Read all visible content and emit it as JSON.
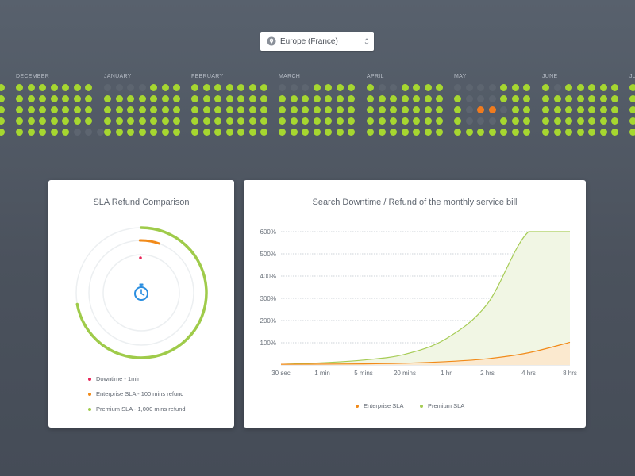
{
  "region": {
    "selected": "Europe (France)",
    "icon": "location-pin-icon"
  },
  "calendar": {
    "months": [
      {
        "label": "DECEMBER",
        "status": "GGGGGGG/GGGGGGG/GGGGGGG/GGGGGGG/GGGGGDDD"
      },
      {
        "label": "JANUARY",
        "status": "DDDDGGG/GGGGGGG/GGGGGGG/GGGGGGG/GGGGGGG"
      },
      {
        "label": "FEBRUARY",
        "status": "GGGGGGG/GGGGGGG/GGGGGGG/GGGGGGG/GGGGGGG"
      },
      {
        "label": "MARCH",
        "status": "DDDGGGG/GGGGGGG/GGGGGGG/GGGGGGG/GGGGGGG"
      },
      {
        "label": "APRIL",
        "status": "GDDGGGG/GGGGGGG/GGGGGGG/GGGGGGG/GGGGGGG"
      },
      {
        "label": "MAY",
        "status": "DDDDGGG/GDDDGGG/GDOODGG/GDDDGGG/GGGGGGG"
      },
      {
        "label": "JUNE",
        "status": "GDGGGGG/GGGGGGG/GGGGGGG/GGGGGGG/GGGGGGG"
      },
      {
        "label": "JU",
        "status": "G/G/G/G/G"
      }
    ],
    "colors": {
      "up": "#a6d730",
      "down": "#5d6570",
      "incident": "#f07b1e"
    }
  },
  "sla_card": {
    "title": "SLA Refund Comparison",
    "center_icon": "stopwatch-icon",
    "legend": [
      {
        "label": "Downtime - 1min",
        "color": "#e8265a"
      },
      {
        "label": "Enterprise SLA - 100 mins refund",
        "color": "#f18a19"
      },
      {
        "label": "Premium SLA - 1,000 mins refund",
        "color": "#9fcb4a"
      }
    ],
    "rings": {
      "downtime_mins": 1,
      "enterprise_mins": 100,
      "premium_mins": 1000
    }
  },
  "downtime_card": {
    "title": "Search Downtime / Refund of the monthly service bill"
  },
  "chart_data": {
    "type": "area",
    "x": [
      "30 sec",
      "1 min",
      "5 mins",
      "20 mins",
      "1 hr",
      "2 hrs",
      "4 hrs",
      "8 hrs"
    ],
    "yticks": [
      "600%",
      "500%",
      "400%",
      "300%",
      "200%",
      "100%"
    ],
    "ylim": [
      0,
      600
    ],
    "series": [
      {
        "name": "Enterprise SLA",
        "color": "#f18a19",
        "fill": "#fbe9cf",
        "values": [
          3,
          4,
          5,
          8,
          15,
          28,
          55,
          102
        ]
      },
      {
        "name": "Premium SLA",
        "color": "#a6cc55",
        "fill": "#f1f6e4",
        "values": [
          3,
          10,
          22,
          48,
          118,
          275,
          600,
          600
        ]
      }
    ]
  }
}
